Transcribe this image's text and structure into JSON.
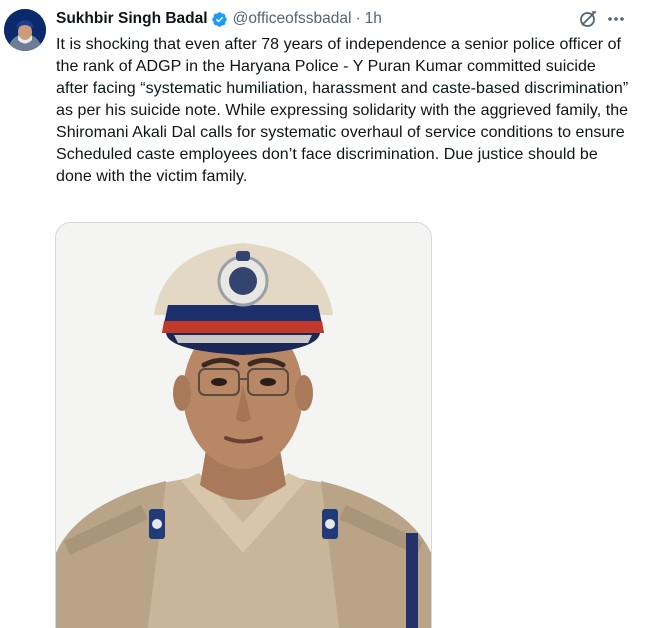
{
  "tweet": {
    "author": {
      "display_name": "Sukhbir Singh Badal",
      "handle": "@officeofssbadal",
      "verified_icon": "verified-badge-icon",
      "avatar_icon": "profile-avatar"
    },
    "separator": "·",
    "time": "1h",
    "actions": {
      "grok_icon": "grok-icon",
      "more_icon": "more-options-icon"
    },
    "text": "It is shocking that even after 78 years of independence a senior police officer of the rank of ADGP in the Haryana Police - Y Puran Kumar committed suicide after facing “systematic humiliation, harassment and caste-based discrimination” as per his suicide note. While expressing solidarity with the aggrieved family, the Shiromani Akali Dal calls for systematic overhaul of service conditions to ensure Scheduled caste employees don’t face discrimination. Due justice should be done with the victim family.",
    "media": {
      "type": "photo",
      "subject": "police-officer-portrait"
    }
  },
  "colors": {
    "text_primary": "#0f1419",
    "text_secondary": "#536471",
    "verified_blue": "#1d9bf0",
    "border": "#cfd9de"
  }
}
